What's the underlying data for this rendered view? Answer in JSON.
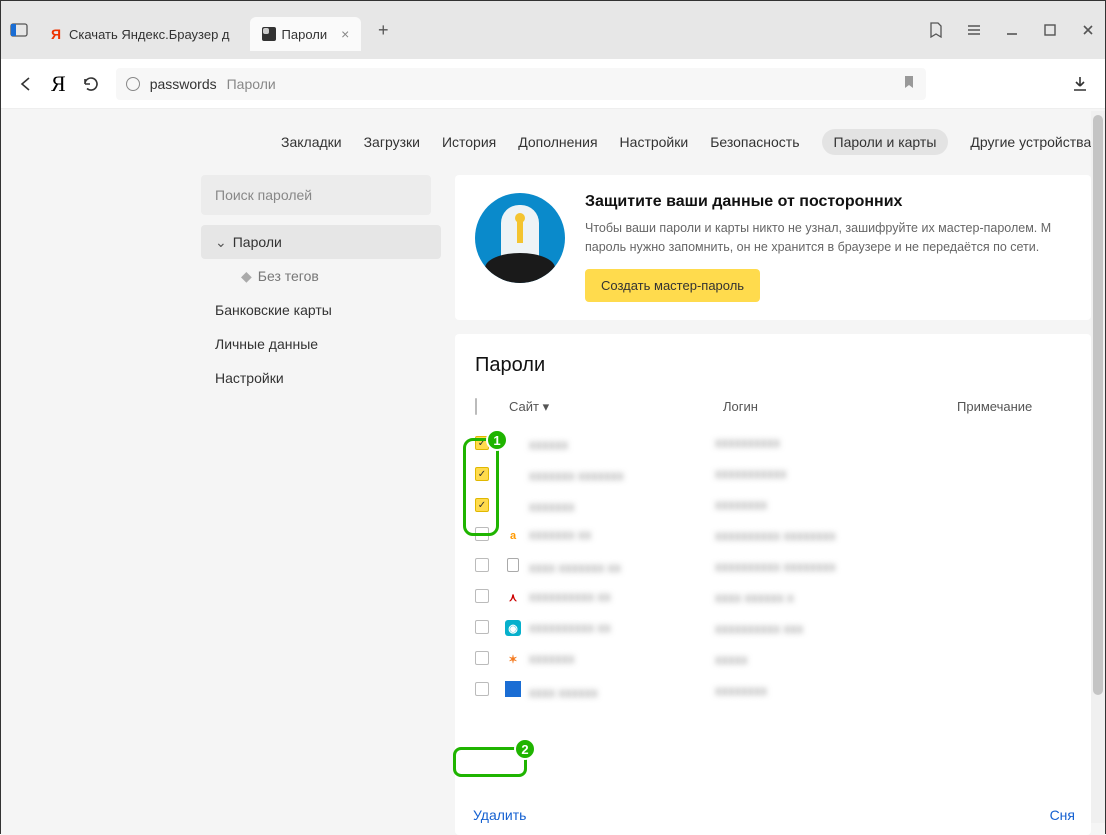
{
  "titlebar": {
    "tab1": "Скачать Яндекс.Браузер д",
    "tab2": "Пароли"
  },
  "addrbar": {
    "host": "passwords",
    "title": "Пароли"
  },
  "topnav": {
    "bookmarks": "Закладки",
    "downloads": "Загрузки",
    "history": "История",
    "addons": "Дополнения",
    "settings": "Настройки",
    "security": "Безопасность",
    "passwords": "Пароли и карты",
    "devices": "Другие устройства"
  },
  "sidebar": {
    "search_placeholder": "Поиск паролей",
    "passwords": "Пароли",
    "notags": "Без тегов",
    "cards": "Банковские карты",
    "personal": "Личные данные",
    "settings": "Настройки"
  },
  "promo": {
    "heading": "Защитите ваши данные от посторонних",
    "body": "Чтобы ваши пароли и карты никто не узнал, зашифруйте их мастер-паролем. М пароль нужно запомнить, он не хранится в браузере и не передаётся по сети.",
    "button": "Создать мастер-пароль"
  },
  "panel": {
    "heading": "Пароли",
    "col_site": "Сайт",
    "col_login": "Логин",
    "col_note": "Примечание",
    "delete": "Удалить",
    "deselect": "Сня"
  },
  "rows": [
    {
      "checked": true,
      "icon": "",
      "site": "xxxxxx",
      "login": "xxxxxxxxxx"
    },
    {
      "checked": true,
      "icon": "",
      "site": "xxxxxxx xxxxxxx",
      "login": "xxxxxxxxxxx"
    },
    {
      "checked": true,
      "icon": "",
      "site": "xxxxxxx",
      "login": "xxxxxxxx"
    },
    {
      "checked": false,
      "icon": "amazon",
      "site": "xxxxxxx xx",
      "login": "xxxxxxxxxx xxxxxxxx"
    },
    {
      "checked": false,
      "icon": "doc",
      "site": "xxxx xxxxxxx xx",
      "login": "xxxxxxxxxx xxxxxxxx"
    },
    {
      "checked": false,
      "icon": "adobe",
      "site": "xxxxxxxxxx xx",
      "login": "xxxx xxxxxx x"
    },
    {
      "checked": false,
      "icon": "teal",
      "site": "xxxxxxxxxx xx",
      "login": "xxxxxxxxxx xxx"
    },
    {
      "checked": false,
      "icon": "avast",
      "site": "xxxxxxx",
      "login": "xxxxx"
    },
    {
      "checked": false,
      "icon": "blue",
      "site": "xxxx xxxxxx",
      "login": "xxxxxxxx"
    }
  ],
  "annotations": {
    "a1": "1",
    "a2": "2"
  }
}
